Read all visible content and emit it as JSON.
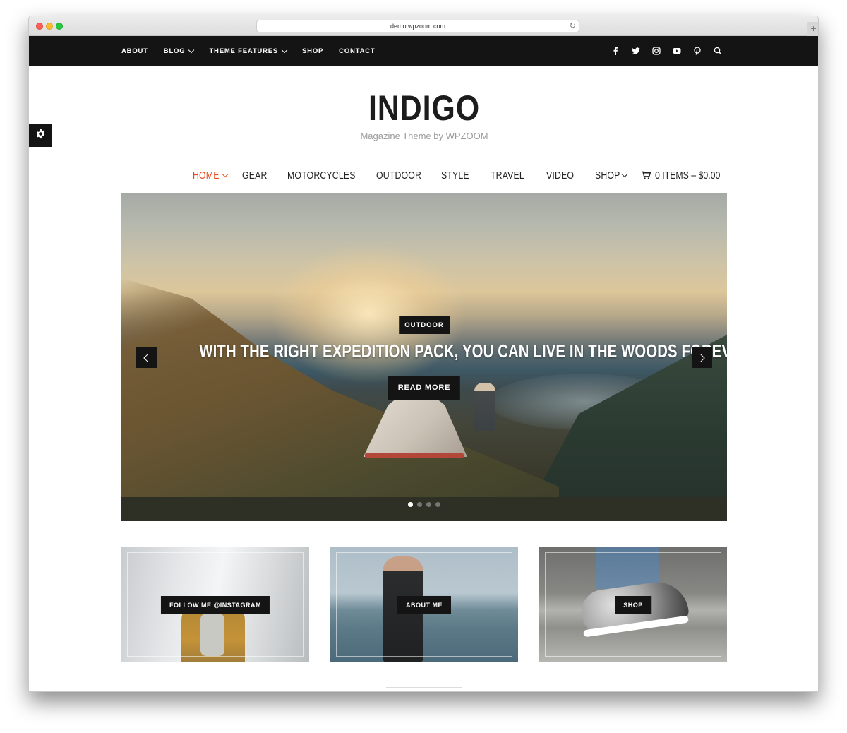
{
  "browser": {
    "url": "demo.wpzoom.com"
  },
  "topbar": {
    "nav": [
      {
        "label": "ABOUT",
        "dropdown": false
      },
      {
        "label": "BLOG",
        "dropdown": true
      },
      {
        "label": "THEME FEATURES",
        "dropdown": true
      },
      {
        "label": "SHOP",
        "dropdown": false
      },
      {
        "label": "CONTACT",
        "dropdown": false
      }
    ],
    "social_icons": [
      "facebook-icon",
      "twitter-icon",
      "instagram-icon",
      "youtube-icon",
      "pinterest-icon",
      "search-icon"
    ]
  },
  "site": {
    "title": "INDIGO",
    "tagline": "Magazine Theme by WPZOOM"
  },
  "mainnav": {
    "items": [
      {
        "label": "HOME",
        "active": true,
        "dropdown": true
      },
      {
        "label": "GEAR",
        "active": false,
        "dropdown": false
      },
      {
        "label": "MOTORCYCLES",
        "active": false,
        "dropdown": false
      },
      {
        "label": "OUTDOOR",
        "active": false,
        "dropdown": false
      },
      {
        "label": "STYLE",
        "active": false,
        "dropdown": false
      },
      {
        "label": "TRAVEL",
        "active": false,
        "dropdown": false
      },
      {
        "label": "VIDEO",
        "active": false,
        "dropdown": false
      },
      {
        "label": "SHOP",
        "active": false,
        "dropdown": true
      }
    ],
    "cart_label": "0 ITEMS – $0.00",
    "accent_color": "#e8491d"
  },
  "slider": {
    "category": "OUTDOOR",
    "title": "WITH THE RIGHT EXPEDITION PACK, YOU CAN LIVE IN THE WOODS FOREVER",
    "button": "READ MORE",
    "slide_count": 4,
    "active_slide": 1
  },
  "cards": [
    {
      "label": "FOLLOW ME @INSTAGRAM"
    },
    {
      "label": "ABOUT ME"
    },
    {
      "label": "SHOP"
    }
  ]
}
